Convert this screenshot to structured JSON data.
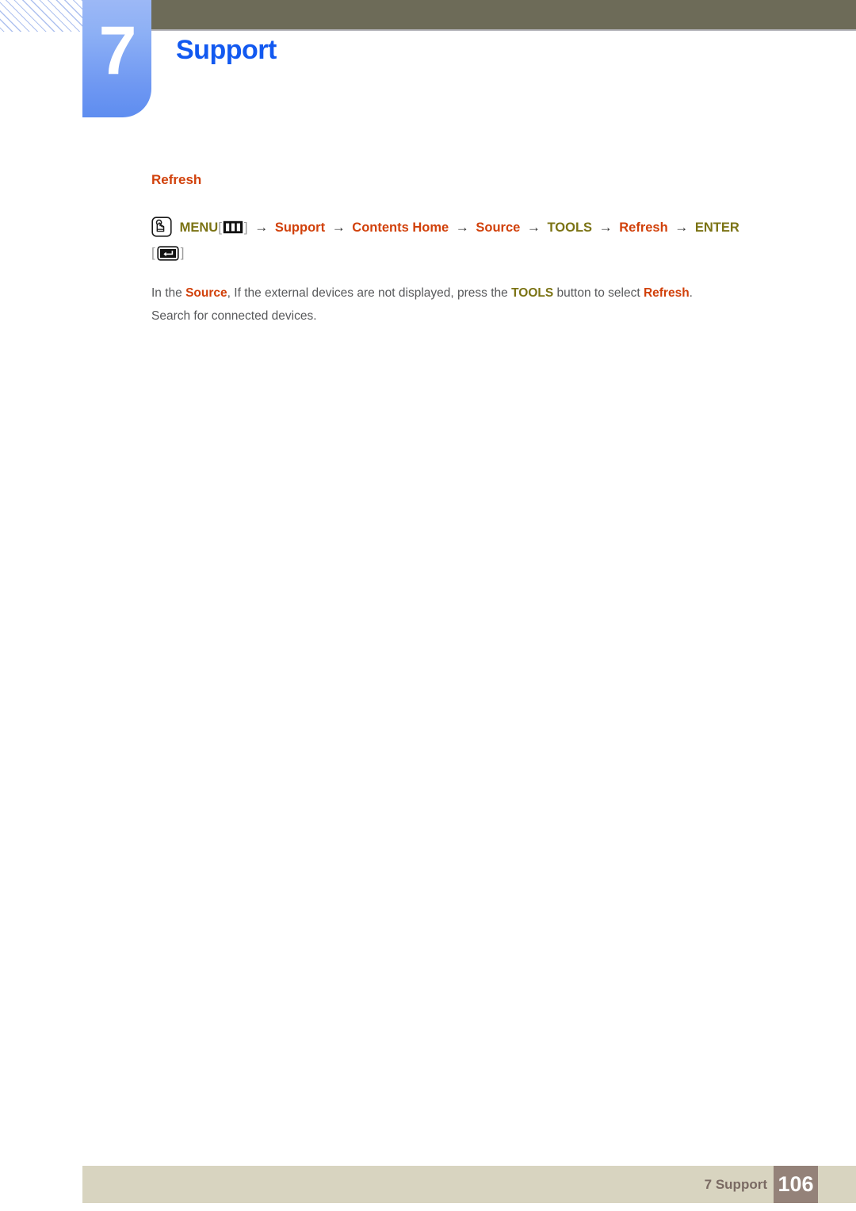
{
  "header": {
    "chapter_number": "7",
    "chapter_title": "Support",
    "chapter_title_color": "#1259f0",
    "olive_bar_color": "#6d6b58",
    "badge_color": "#7fa3f4"
  },
  "content": {
    "section_heading": "Refresh",
    "section_heading_color": "#d1410b",
    "menu_path": {
      "press_icon": "hand-press-icon",
      "menu_label": "MENU",
      "open_bracket": "[",
      "menu_icon": "menu-bars-icon",
      "close_bracket": "]",
      "arrow": "→",
      "step_support": "Support",
      "step_contents_home": "Contents Home",
      "step_source": "Source",
      "step_tools": "TOOLS",
      "step_refresh": "Refresh",
      "step_enter": "ENTER",
      "enter_open_bracket": "[",
      "enter_icon": "enter-key-icon",
      "enter_close_bracket": "]"
    },
    "body": {
      "part1": "In the ",
      "kw_source": "Source",
      "part2": ", If the external devices are not displayed, press the ",
      "kw_tools": "TOOLS",
      "part3": " button to select ",
      "kw_refresh": "Refresh",
      "part4": ".",
      "line2": "Search for connected devices."
    }
  },
  "footer": {
    "label": "7 Support",
    "page_number": "106",
    "bar_color": "#d8d4c0",
    "page_box_color": "#948279"
  }
}
